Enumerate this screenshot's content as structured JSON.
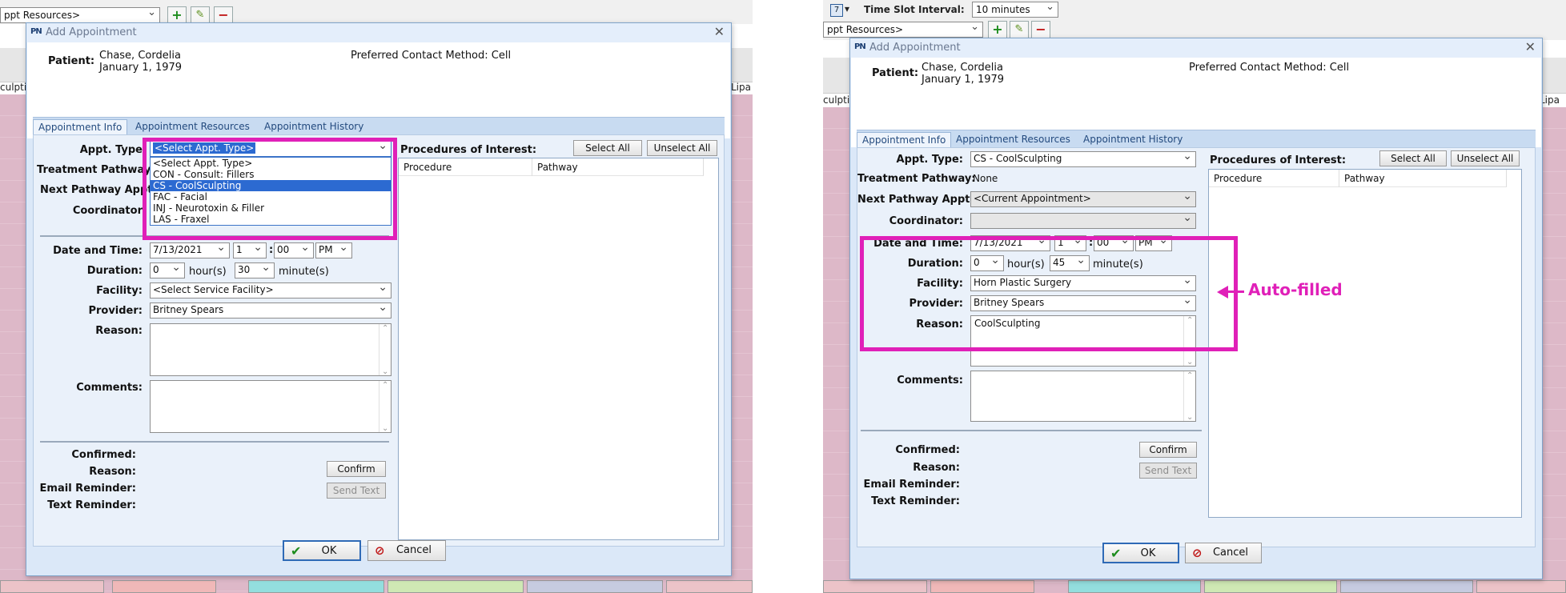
{
  "left": {
    "background": {
      "resource_select": "ppt Resources>",
      "sidebar_fragment": "culptin",
      "right_fragment": "Lipa"
    },
    "dialog": {
      "title": "Add Appointment",
      "patient_label": "Patient:",
      "patient_name": "Chase, Cordelia",
      "patient_dob": "January 1, 1979",
      "contact_method": "Preferred Contact Method: Cell",
      "tabs": [
        "Appointment Info",
        "Appointment Resources",
        "Appointment History"
      ],
      "labels": {
        "appt_type": "Appt. Type",
        "treatment_pathway": "Treatment Pathway",
        "next_pathway": "Next Pathway Appt",
        "coordinator": "Coordinator",
        "date_time": "Date and Time:",
        "duration": "Duration:",
        "facility": "Facility:",
        "provider": "Provider:",
        "reason": "Reason:",
        "comments": "Comments:",
        "confirmed": "Confirmed:",
        "reason2": "Reason:",
        "email_reminder": "Email Reminder:",
        "text_reminder": "Text Reminder:",
        "hours": "hour(s)",
        "minutes": "minute(s)",
        "colon": ":"
      },
      "appt_type_value": "<Select Appt. Type>",
      "appt_type_options": [
        "<Select Appt. Type>",
        "CON - Consult: Fillers",
        "CS - CoolSculpting",
        "FAC - Facial",
        "INJ - Neurotoxin & Filler",
        "LAS - Fraxel"
      ],
      "appt_type_highlighted": 2,
      "date": "7/13/2021",
      "hour": "1",
      "minute": "00",
      "ampm": "PM",
      "duration_hours": "0",
      "duration_minutes": "30",
      "facility": "<Select Service Facility>",
      "provider": "Britney Spears",
      "reason": "",
      "comments": "",
      "procedures_label": "Procedures of Interest:",
      "select_all": "Select All",
      "unselect_all": "Unselect All",
      "proc_columns": [
        "Procedure",
        "Pathway"
      ],
      "confirm_btn": "Confirm",
      "send_text_btn": "Send Text",
      "ok_btn": "OK",
      "cancel_btn": "Cancel"
    }
  },
  "right": {
    "background": {
      "time_slot_label": "Time Slot Interval:",
      "time_slot_value": "10 minutes",
      "resource_select": "ppt Resources>",
      "sidebar_fragment": "culptin",
      "right_fragment": "Lipa"
    },
    "dialog": {
      "title": "Add Appointment",
      "patient_label": "Patient:",
      "patient_name": "Chase, Cordelia",
      "patient_dob": "January 1, 1979",
      "contact_method": "Preferred Contact Method: Cell",
      "tabs": [
        "Appointment Info",
        "Appointment Resources",
        "Appointment History"
      ],
      "labels": {
        "appt_type": "Appt. Type:",
        "treatment_pathway": "Treatment Pathway:",
        "next_pathway": "Next Pathway Appt:",
        "coordinator": "Coordinator:",
        "date_time": "Date and Time:",
        "duration": "Duration:",
        "facility": "Facility:",
        "provider": "Provider:",
        "reason": "Reason:",
        "comments": "Comments:",
        "confirmed": "Confirmed:",
        "reason2": "Reason:",
        "email_reminder": "Email Reminder:",
        "text_reminder": "Text Reminder:",
        "hours": "hour(s)",
        "minutes": "minute(s)",
        "colon": ":"
      },
      "appt_type_value": "CS - CoolSculpting",
      "treatment_pathway_value": "None",
      "next_pathway_value": "<Current Appointment>",
      "coordinator_value": "",
      "date": "7/13/2021",
      "hour": "1",
      "minute": "00",
      "ampm": "PM",
      "duration_hours": "0",
      "duration_minutes": "45",
      "facility": "Horn Plastic Surgery",
      "provider": "Britney Spears",
      "reason": "CoolSculpting",
      "comments": "",
      "procedures_label": "Procedures of Interest:",
      "select_all": "Select All",
      "unselect_all": "Unselect All",
      "proc_columns": [
        "Procedure",
        "Pathway"
      ],
      "confirm_btn": "Confirm",
      "send_text_btn": "Send Text",
      "ok_btn": "OK",
      "cancel_btn": "Cancel"
    },
    "annotation": "Auto-filled"
  },
  "colors": {
    "highlight": "#e020b8",
    "selection": "#2c6ad1",
    "dialog_bg": "#dbe8f8"
  }
}
